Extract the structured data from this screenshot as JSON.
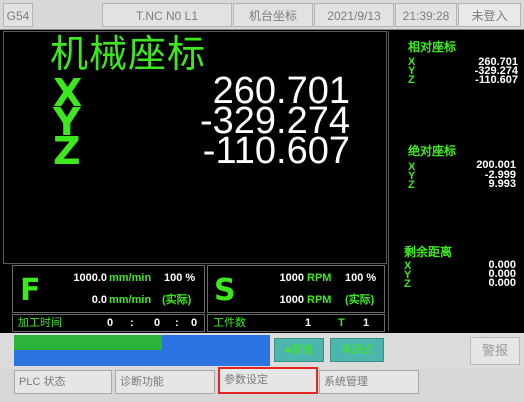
{
  "topbar": {
    "coord_system": "G54",
    "tool_info": "T.NC N0 L1",
    "screen_name": "机台坐标",
    "date": "2021/9/13",
    "time": "21:39:28",
    "login": "未登入"
  },
  "main": {
    "title": "机械座标",
    "axes": [
      {
        "label": "X",
        "value": "260.701"
      },
      {
        "label": "Y",
        "value": "-329.274"
      },
      {
        "label": "Z",
        "value": "-110.607"
      }
    ]
  },
  "side": {
    "relative": {
      "title": "相对座标",
      "axes": [
        {
          "label": "X",
          "value": "260.701"
        },
        {
          "label": "Y",
          "value": "-329.274"
        },
        {
          "label": "Z",
          "value": "-110.607"
        }
      ]
    },
    "absolute": {
      "title": "绝对座标",
      "axes": [
        {
          "label": "X",
          "value": "200.001"
        },
        {
          "label": "Y",
          "value": "-2.999"
        },
        {
          "label": "Z",
          "value": "9.993"
        }
      ]
    },
    "remaining": {
      "title": "剩余距离",
      "axes": [
        {
          "label": "X",
          "value": "0.000"
        },
        {
          "label": "Y",
          "value": "0.000"
        },
        {
          "label": "Z",
          "value": "0.000"
        }
      ]
    }
  },
  "feed": {
    "letter": "F",
    "command_value": "1000.0",
    "command_unit": "mm/min",
    "override": "100 %",
    "actual_value": "0.0",
    "actual_unit": "mm/min",
    "actual_tag": "(实际)"
  },
  "spindle": {
    "letter": "S",
    "command_value": "1000",
    "command_unit": "RPM",
    "override": "100 %",
    "actual_value": "1000",
    "actual_unit": "RPM",
    "actual_tag": "(实际)"
  },
  "counters": {
    "cycle_time_label": "加工时间",
    "hours": "0",
    "minutes": "0",
    "seconds": "0",
    "sep1": ":",
    "sep2": ":",
    "parts_label": "工件数",
    "parts_count": "1",
    "tool_label": "T",
    "tool_value": "1"
  },
  "status": {
    "ready_label": "就绪",
    "home_label": "寻原点",
    "alarm_label": "警报",
    "progress": 0.58
  },
  "softkeys": [
    {
      "label": "PLC 状态"
    },
    {
      "label": "诊断功能"
    },
    {
      "label": "参数设定"
    },
    {
      "label": "系统管理"
    }
  ],
  "colors": {
    "green": "#3ee81f",
    "progress_green": "#2cb43a",
    "progress_blue": "#2b73e0",
    "ready_bg": "#4db6ac",
    "highlight_red": "#e5231f"
  }
}
